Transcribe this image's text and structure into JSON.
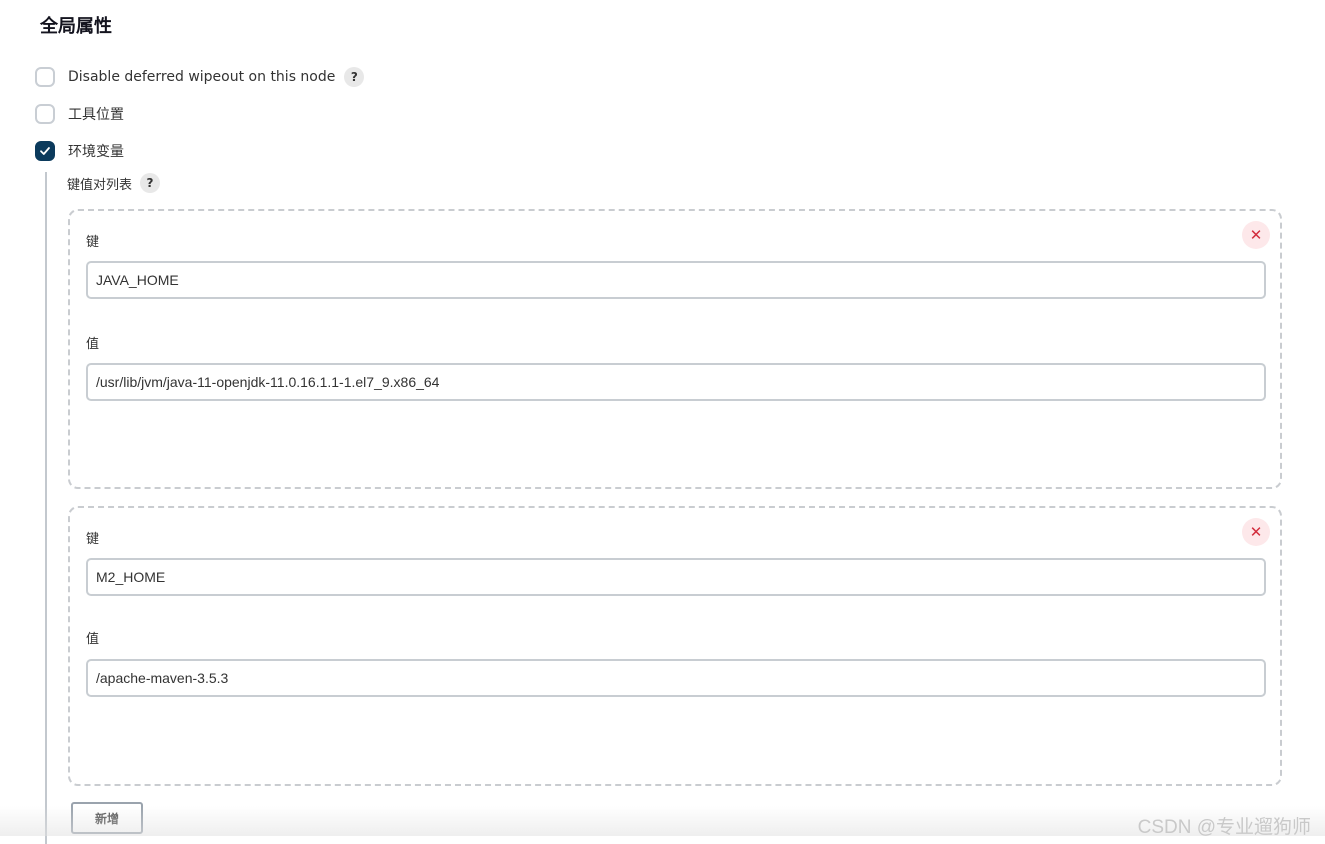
{
  "section": {
    "title": "全局属性"
  },
  "options": [
    {
      "label": "Disable deferred wipeout on this node",
      "checked": false,
      "has_help": true
    },
    {
      "label": "工具位置",
      "checked": false,
      "has_help": false
    },
    {
      "label": "环境变量",
      "checked": true,
      "has_help": false
    }
  ],
  "env": {
    "list_label": "键值对列表",
    "help_label": "?",
    "entries": [
      {
        "key_label": "键",
        "key": "JAVA_HOME",
        "value_label": "值",
        "value": "/usr/lib/jvm/java-11-openjdk-11.0.16.1.1-1.el7_9.x86_64",
        "delete_icon": "close-icon",
        "delete_symbol": "✕"
      },
      {
        "key_label": "键",
        "key": "M2_HOME",
        "value_label": "值",
        "value": "/apache-maven-3.5.3",
        "delete_icon": "close-icon",
        "delete_symbol": "✕"
      }
    ],
    "add_label": "新增"
  },
  "watermark": "CSDN @专业遛狗师",
  "colors": {
    "checkbox_checked": "#0b3a5c",
    "delete_bg": "#fde8ea",
    "delete_fg": "#d22d3d"
  }
}
